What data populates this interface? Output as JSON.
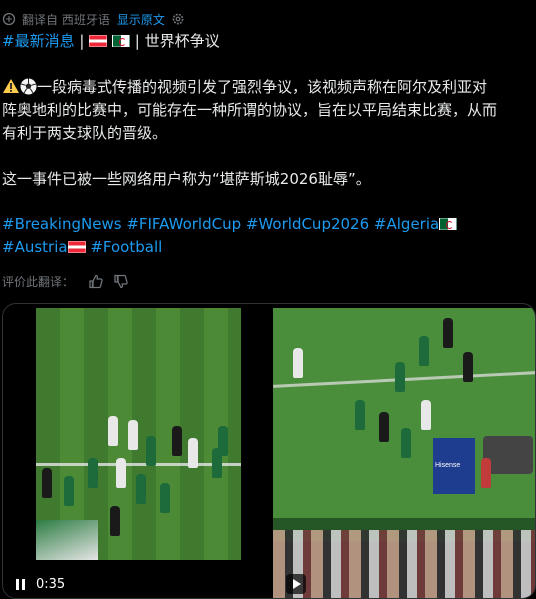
{
  "translate_bar": {
    "label": "翻译自 西班牙语",
    "show_original": "显示原文"
  },
  "post": {
    "header_tag": "#最新消息",
    "header_sep": "|",
    "header_sep2": "|",
    "header_title": "世界杯争议",
    "body_line1": "一段病毒式传播的视频引发了强烈争议，该视频声称在阿尔及利亚对",
    "body_line2": "阵奥地利的比赛中，可能存在一种所谓的协议，旨在以平局结束比赛，从而",
    "body_line3": "有利于两支球队的晋级。",
    "body_line4": "这一事件已被一些网络用户称为“堪萨斯城2026耻辱”。",
    "hashtags_row1": [
      "#BreakingNews",
      "#FIFAWorldCup",
      "#WorldCup2026",
      "#Algeria"
    ],
    "hashtags_row2": [
      "#Austria",
      "#Football"
    ]
  },
  "rate": {
    "label": "评价此翻译："
  },
  "media": {
    "time": "0:35",
    "sign_text": "Hisense"
  },
  "icons": [
    "translate-icon",
    "gear-icon",
    "warning-icon",
    "soccer-ball-icon",
    "thumbs-up-icon",
    "thumbs-down-icon",
    "pause-icon",
    "play-icon"
  ]
}
